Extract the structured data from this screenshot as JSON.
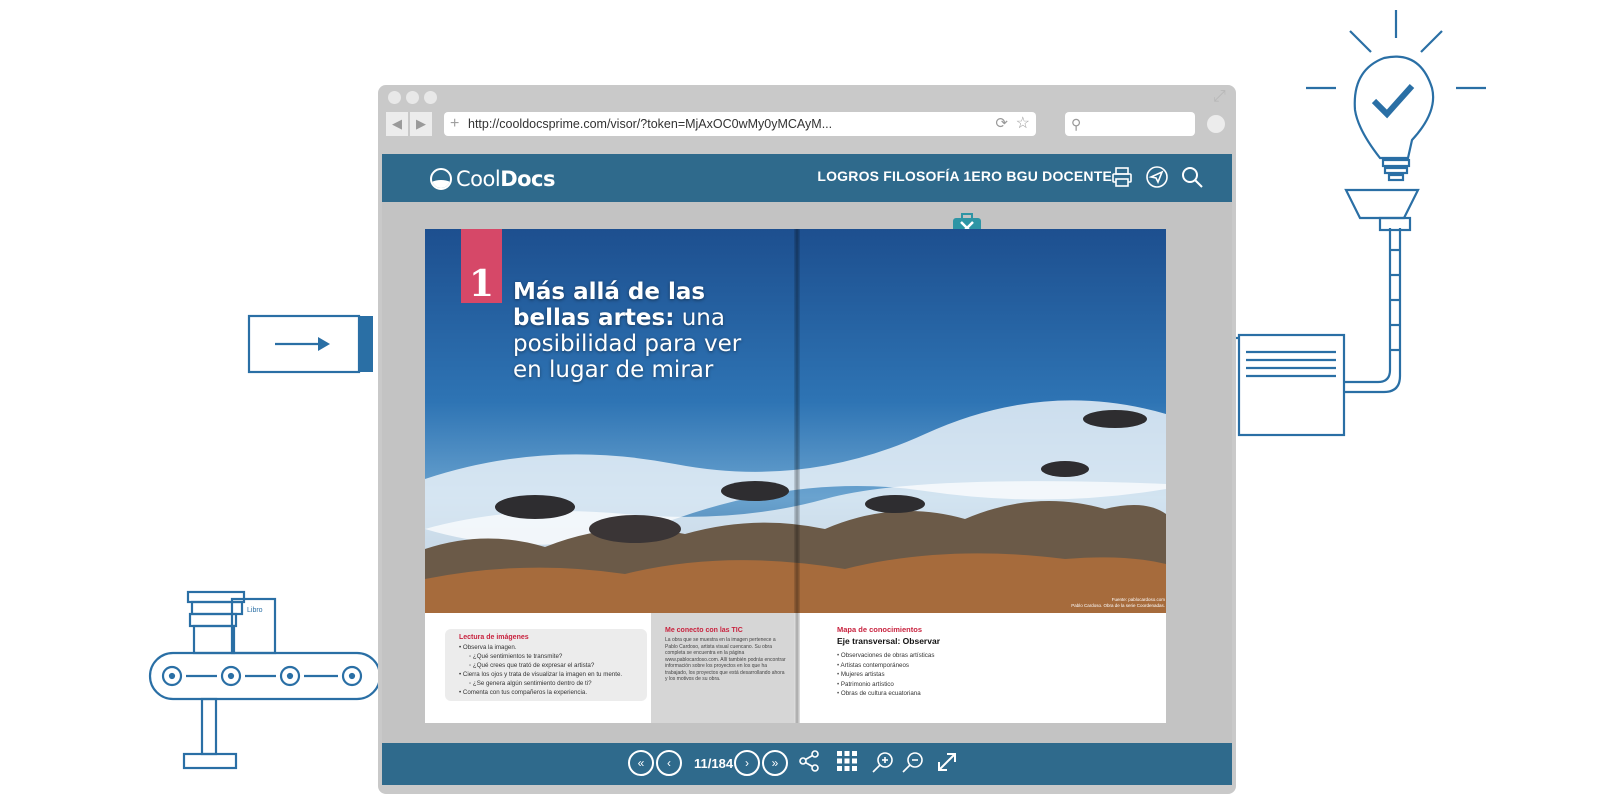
{
  "browser": {
    "url": "http://cooldocsprime.com/visor/?token=MjAxOC0wMy0yMCAyM...",
    "back_icon": "back-arrow-icon",
    "forward_icon": "forward-arrow-icon"
  },
  "viewer": {
    "brand_light": "Cool",
    "brand_bold": "Docs",
    "doc_title": "LOGROS FILOSOFÍA 1ERO BGU DOCENTE",
    "accent": "#2f6a8c",
    "page_indicator": "11/184"
  },
  "book": {
    "unit_number": "1",
    "headline_bold_1": "Más allá de las",
    "headline_bold_2": "bellas artes:",
    "headline_light_1": " una",
    "headline_light_2": "posibilidad para ver",
    "headline_light_3": "en lugar de mirar",
    "credit_line_1": "Fuente: pablocardoso.com",
    "credit_line_2": "Pablo Cardoso. Obra de la serie Coordenadas.",
    "lectura": {
      "title": "Lectura de imágenes",
      "items": [
        "• Observa la imagen.",
        "◦ ¿Qué sentimientos te transmite?",
        "◦ ¿Qué crees que trató de expresar el artista?",
        "• Cierra los ojos y trata de visualizar la imagen en tu mente.",
        "◦ ¿Se genera algún sentimiento dentro de ti?",
        "• Comenta con tus compañeros la experiencia."
      ]
    },
    "tic": {
      "title": "Me conecto con las TIC",
      "body": "La obra que se muestra en la imagen pertenece a Pablo Cardoso, artista visual cuencano. Su obra completa se encuentra en la página www.pablocardoso.com. Allí también podrás encontrar información sobre los proyectos en los que ha trabajado, los proyectos que está desarrollando ahora y los motivos de su obra."
    },
    "mapa": {
      "title": "Mapa de conocimientos",
      "subtitle": "Eje transversal: Observar",
      "items": [
        "Observaciones de obras artísticas",
        "Artistas contemporáneos",
        "Mujeres artistas",
        "Patrimonio artístico",
        "Obras de cultura ecuatoriana"
      ]
    }
  },
  "decor": {
    "book_label": "Libro",
    "line_color": "#2a6fa5"
  }
}
